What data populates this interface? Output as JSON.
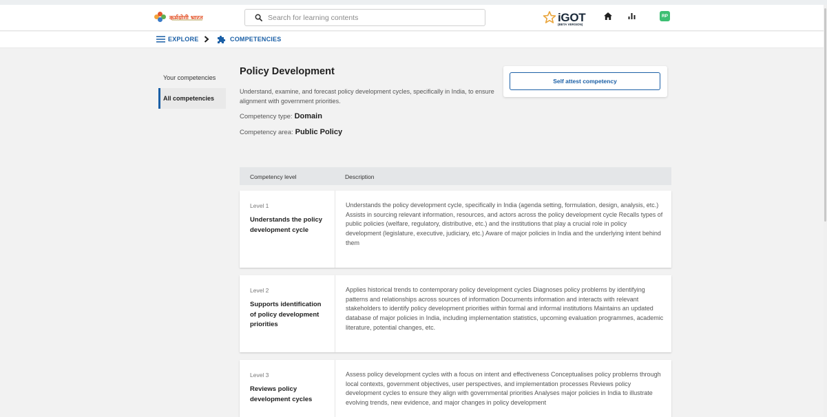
{
  "header": {
    "logo_text": "कर्मयोगी भारत",
    "search_placeholder": "Search for learning contents",
    "brand_name": "iGOT",
    "brand_badge": "(BETA VERSION)",
    "avatar_initials": "RP"
  },
  "breadcrumb": {
    "explore": "EXPLORE",
    "competencies": "COMPETENCIES"
  },
  "sidebar": {
    "items": [
      {
        "label": "Your competencies",
        "active": false
      },
      {
        "label": "All competencies",
        "active": true
      }
    ]
  },
  "competency": {
    "title": "Policy Development",
    "description": "Understand, examine, and forecast policy development cycles, specifically in India, to ensure alignment with government priorities.",
    "type_label": "Competency type:",
    "type_value": "Domain",
    "area_label": "Competency area:",
    "area_value": "Public Policy",
    "attest_button": "Self attest competency"
  },
  "table": {
    "col_level": "Competency level",
    "col_description": "Description",
    "rows": [
      {
        "level": "Level 1",
        "name": "Understands the policy development cycle",
        "description": "Understands the policy development cycle, specifically in India (agenda setting, formulation, design, analysis, etc.) Assists in sourcing relevant information, resources, and actors across the policy development cycle Recalls types of public policies (welfare, regulatory, distributive, etc.) and the institutions that play a crucial role in policy development (legislature, executive, judiciary, etc.) Aware of major policies in India and the underlying intent behind them"
      },
      {
        "level": "Level 2",
        "name": "Supports identification of policy development priorities",
        "description": "Applies historical trends to contemporary policy development cycles Diagnoses policy problems by identifying patterns and relationships across sources of information Documents information and interacts with relevant stakeholders to identify policy development priorities within formal and informal institutions Maintains an updated database of major policies in India, including implementation statistics, upcoming evaluation programmes, academic literature, potential changes, etc."
      },
      {
        "level": "Level 3",
        "name": "Reviews policy development cycles",
        "description": "Assess policy development cycles with a focus on intent and effectiveness Conceptualises policy problems through local contexts, government objectives, user perspectives, and implementation processes Reviews policy development cycles to ensure they align with governmental priorities Analyses major policies in India to illustrate evolving trends, new evidence, and major changes in policy development"
      }
    ]
  },
  "colors": {
    "primary": "#1a5fa6",
    "avatar": "#3dbf73",
    "page_bg": "#f2f2f2"
  }
}
